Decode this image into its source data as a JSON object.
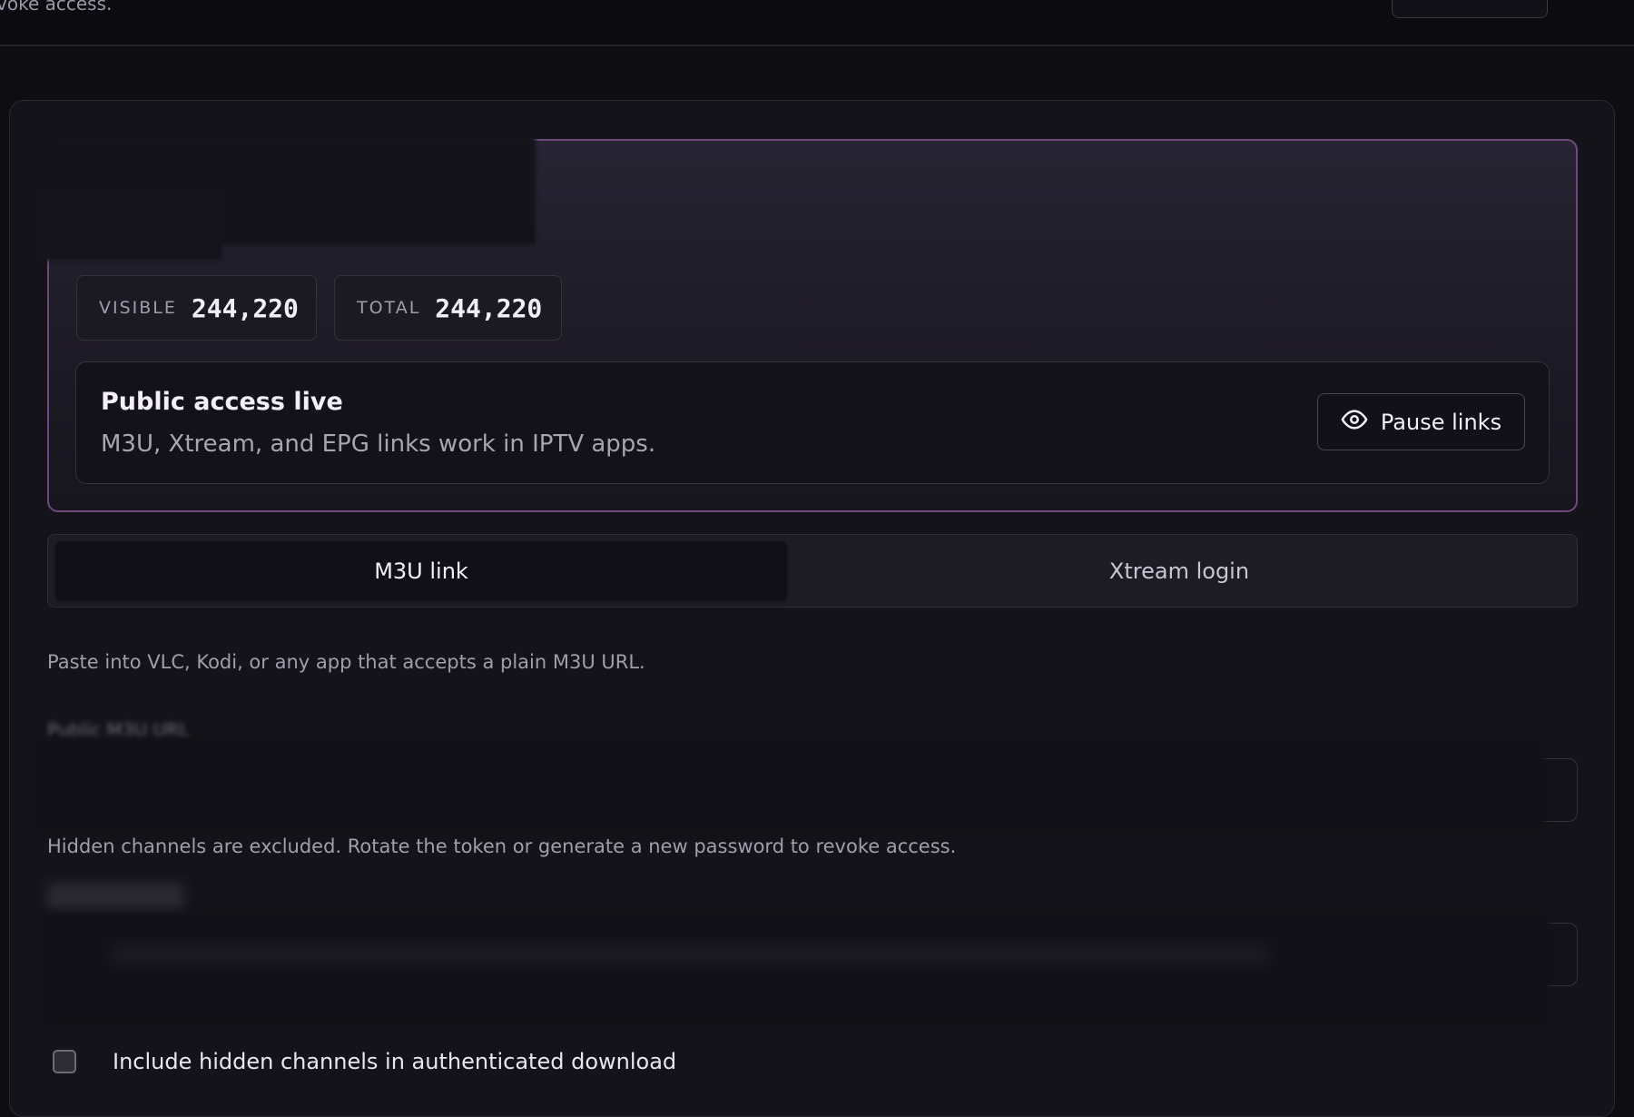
{
  "top": {
    "text": "voke access."
  },
  "stats": [
    {
      "label": "VISIBLE",
      "value": "244,220"
    },
    {
      "label": "TOTAL",
      "value": "244,220"
    }
  ],
  "status": {
    "title": "Public access live",
    "description": "M3U, Xtream, and EPG links work in IPTV apps.",
    "pause_label": "Pause links",
    "pause_icon": "eye-icon"
  },
  "tabs": [
    {
      "label": "M3U link",
      "active": true
    },
    {
      "label": "Xtream login",
      "active": false
    }
  ],
  "m3u": {
    "hint": "Paste into VLC, Kodi, or any app that accepts a plain M3U URL.",
    "url_label": "Public M3U URL",
    "helper": "Hidden channels are excluded. Rotate the token or generate a new password to revoke access."
  },
  "options": {
    "include_hidden_label": "Include hidden channels in authenticated download",
    "include_hidden_checked": false
  },
  "colors": {
    "background": "#0e0d12",
    "accent_border": "#6c4b7c",
    "text_primary": "#f2f0f6",
    "text_muted": "#a19eac"
  }
}
